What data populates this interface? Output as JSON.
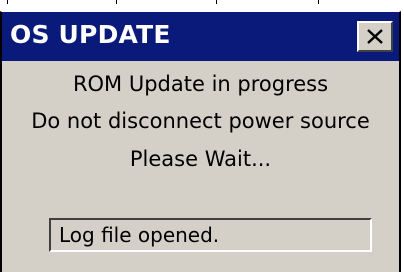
{
  "dialog": {
    "title": "OS UPDATE",
    "close_label": "×",
    "icons": {
      "close": "close-icon"
    },
    "messages": {
      "line1": "ROM Update in progress",
      "line2": "Do not disconnect power source",
      "line3": "Please Wait..."
    },
    "log": {
      "value": "Log file opened."
    }
  },
  "colors": {
    "titlebar": "#0a1a7a",
    "dialog_face": "#d4d0c8",
    "title_text": "#ffffff",
    "text": "#000000"
  }
}
